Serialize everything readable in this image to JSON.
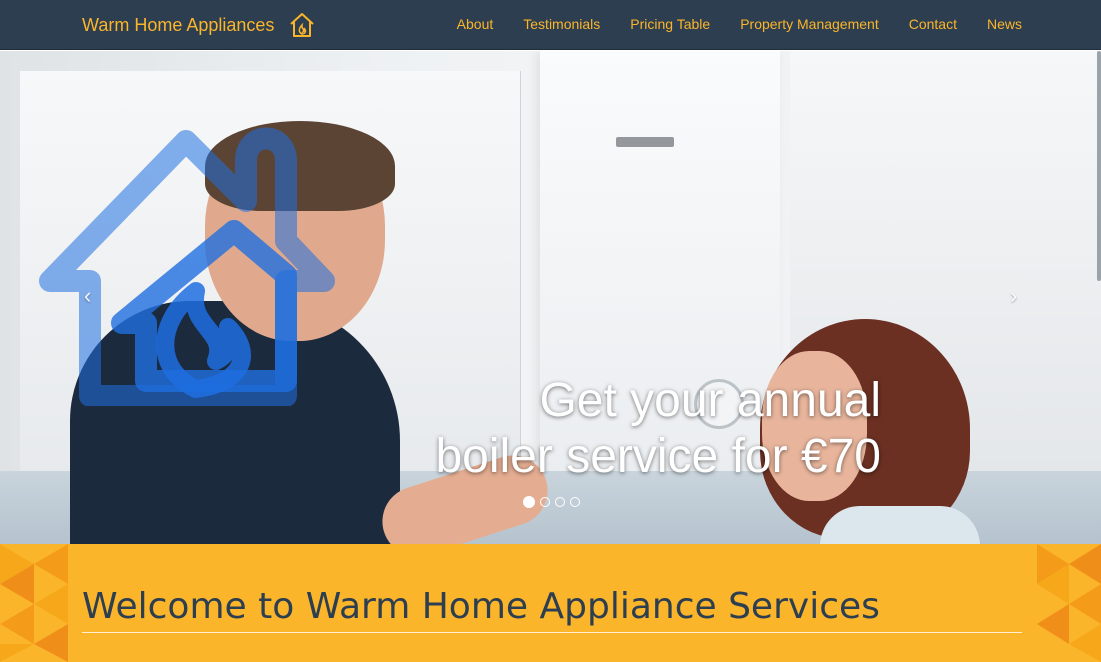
{
  "brand": {
    "name": "Warm Home Appliances",
    "icon": "house-icon"
  },
  "nav": {
    "items": [
      {
        "label": "About"
      },
      {
        "label": "Testimonials"
      },
      {
        "label": "Pricing Table"
      },
      {
        "label": "Property Management"
      },
      {
        "label": "Contact"
      },
      {
        "label": "News"
      }
    ]
  },
  "hero": {
    "caption_line1": "Get your annual",
    "caption_line2": "boiler service for €70",
    "prev": "‹",
    "next": "›",
    "slide_count": 4,
    "active_slide": 1
  },
  "welcome": {
    "title": "Welcome to Warm Home Appliance Services"
  },
  "colors": {
    "nav_bg": "#2c3e50",
    "accent": "#fbb52a",
    "logo_blue": "#1f6fe0"
  }
}
